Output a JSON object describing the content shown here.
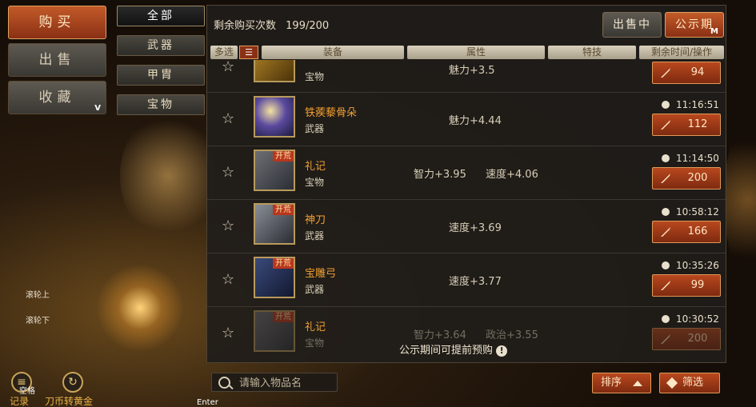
{
  "left_nav": {
    "buy": "购买",
    "sell": "出售",
    "favorite": "收藏",
    "favorite_hotkey": "V",
    "scroll_up": "滚轮上",
    "scroll_down": "滚轮下",
    "records": "记录",
    "exchange": "刀币转黄金",
    "space_hint": "空格",
    "enter_hint": "Enter"
  },
  "categories": [
    "全部",
    "武器",
    "甲胄",
    "宝物"
  ],
  "header": {
    "remaining_label": "剩余购买次数",
    "remaining_value": "199/200",
    "btn_sell": "出售中",
    "btn_notice": "公示期",
    "notice_hotkey": "M"
  },
  "columns": {
    "multi_select": "多选",
    "equipment": "装备",
    "attribute": "属性",
    "skill": "特技",
    "time_action": "剩余时间/操作"
  },
  "items": [
    {
      "name": "",
      "type": "宝物",
      "tag": "",
      "attrs": [
        "魅力+3.5"
      ],
      "time": "",
      "price": "94",
      "icon": "chest-icon"
    },
    {
      "name": "铁蒺藜骨朵",
      "type": "武器",
      "tag": "",
      "attrs": [
        "魅力+4.44"
      ],
      "time": "11:16:51",
      "price": "112",
      "icon": "mace-icon"
    },
    {
      "name": "礼记",
      "type": "宝物",
      "tag": "开荒",
      "attrs": [
        "智力+3.95",
        "速度+4.06"
      ],
      "time": "11:14:50",
      "price": "200",
      "icon": "book-icon"
    },
    {
      "name": "神刀",
      "type": "武器",
      "tag": "开荒",
      "attrs": [
        "速度+3.69"
      ],
      "time": "10:58:12",
      "price": "166",
      "icon": "blade-icon"
    },
    {
      "name": "宝雕弓",
      "type": "武器",
      "tag": "开荒",
      "attrs": [
        "速度+3.77"
      ],
      "time": "10:35:26",
      "price": "99",
      "icon": "bow-icon"
    },
    {
      "name": "礼记",
      "type": "宝物",
      "tag": "开荒",
      "attrs": [
        "智力+3.64",
        "政治+3.55"
      ],
      "time": "10:30:52",
      "price": "200",
      "icon": "book-icon"
    }
  ],
  "notice_text": "公示期间可提前预购",
  "search": {
    "placeholder": "请输入物品名"
  },
  "sort_label": "排序",
  "filter_label": "筛选",
  "colors": {
    "accent": "#b8481e",
    "item_name": "#f0a030",
    "panel": "#201d1a"
  }
}
